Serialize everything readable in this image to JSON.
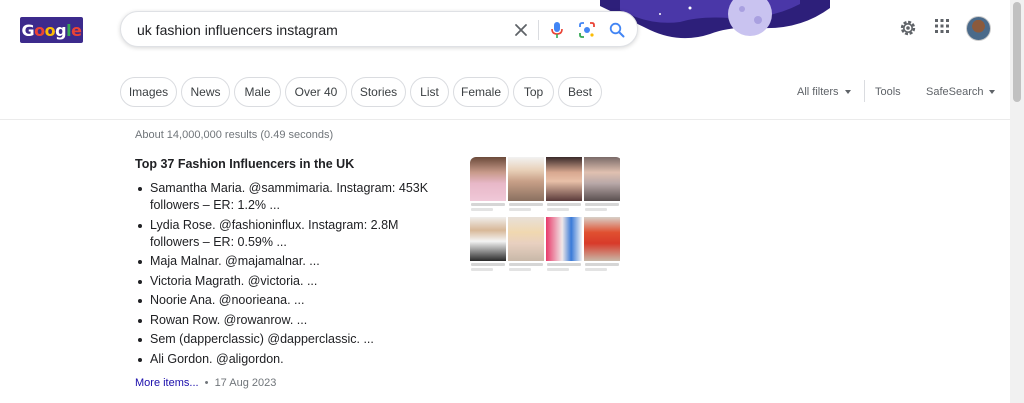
{
  "logo": {
    "letters": [
      "G",
      "o",
      "o",
      "g",
      "l",
      "e"
    ],
    "colors": [
      "#ffffff",
      "#ea4335",
      "#fbbc05",
      "#ffffff",
      "#34a853",
      "#ea4335"
    ]
  },
  "search": {
    "query": "uk fashion influencers instagram",
    "placeholder": ""
  },
  "icons": {
    "clear": "close-icon",
    "voice": "microphone-icon",
    "lens": "lens-icon",
    "search": "search-icon",
    "settings": "gear-icon",
    "apps": "apps-grid-icon",
    "avatar": "user-avatar"
  },
  "chips": [
    "Images",
    "News",
    "Male",
    "Over 40",
    "Stories",
    "List",
    "Female",
    "Top",
    "Best"
  ],
  "filters": {
    "all_filters": "All filters",
    "tools": "Tools",
    "safesearch": "SafeSearch"
  },
  "results": {
    "stats": "About 14,000,000 results (0.49 seconds)",
    "title": "Top 37 Fashion Influencers in the UK",
    "items": [
      "Samantha Maria. @sammimaria. Instagram: 453K followers – ER: 1.2% ...",
      "Lydia Rose. @fashioninflux. Instagram: 2.8M followers – ER: 0.59% ...",
      "Maja Malnar. @majamalnar. ...",
      "Victoria Magrath. @victoria. ...",
      "Noorie Ana. @noorieana. ...",
      "Rowan Row. @rowanrow. ...",
      "Sem (dapperclassic) @dapperclassic. ...",
      "Ali Gordon. @aligordon."
    ],
    "more_link": "More items...",
    "bullet_sep": "•",
    "date": "17 Aug 2023"
  },
  "colors": {
    "link": "#1a0dab",
    "accent": "#4285f4",
    "doodle": "#3c2a8c"
  }
}
